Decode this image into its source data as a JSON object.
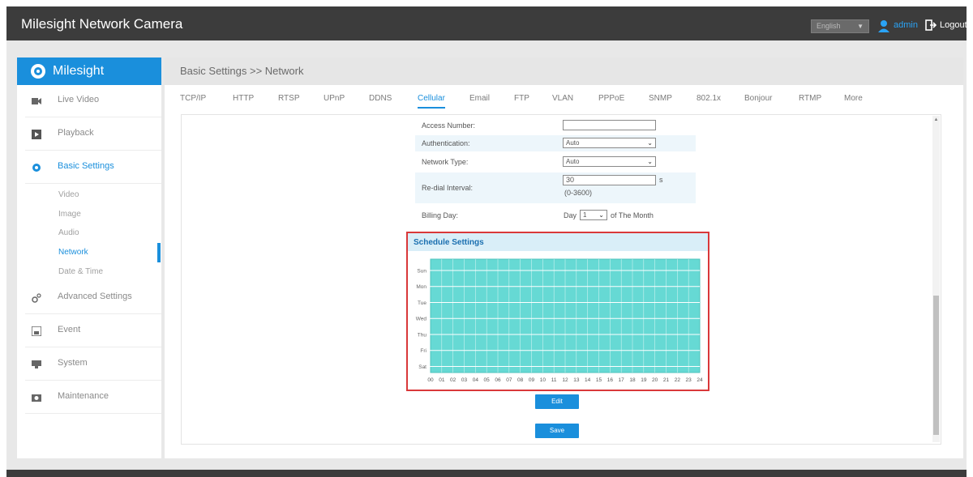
{
  "header": {
    "app_title": "Milesight Network Camera",
    "language": "English",
    "user": "admin",
    "logout": "Logout"
  },
  "sidebar": {
    "logo_text": "Milesight",
    "items": [
      {
        "label": "Live Video",
        "icon": "video-icon"
      },
      {
        "label": "Playback",
        "icon": "playback-icon"
      },
      {
        "label": "Basic Settings",
        "icon": "gear-icon"
      },
      {
        "label": "Advanced Settings",
        "icon": "advanced-gear-icon"
      },
      {
        "label": "Event",
        "icon": "event-icon"
      },
      {
        "label": "System",
        "icon": "system-icon"
      },
      {
        "label": "Maintenance",
        "icon": "maintenance-icon"
      }
    ],
    "sub_items": [
      "Video",
      "Image",
      "Audio",
      "Network",
      "Date & Time"
    ],
    "active_item": "Basic Settings",
    "active_sub_item": "Network"
  },
  "breadcrumb": "Basic Settings >> Network",
  "tabs": [
    "TCP/IP",
    "HTTP",
    "RTSP",
    "UPnP",
    "DDNS",
    "Cellular",
    "Email",
    "FTP",
    "VLAN",
    "PPPoE",
    "SNMP",
    "802.1x",
    "Bonjour",
    "RTMP",
    "More"
  ],
  "active_tab": "Cellular",
  "form": {
    "access_number": {
      "label": "Access Number:",
      "value": ""
    },
    "authentication": {
      "label": "Authentication:",
      "value": "Auto"
    },
    "network_type": {
      "label": "Network Type:",
      "value": "Auto"
    },
    "redial_interval": {
      "label": "Re-dial Interval:",
      "value": "30",
      "unit": "s",
      "range": "(0-3600)"
    },
    "billing_day": {
      "label": "Billing Day:",
      "prefix": "Day",
      "value": "1",
      "suffix": "of The Month"
    }
  },
  "schedule": {
    "title": "Schedule Settings",
    "days": [
      "Sun",
      "Mon",
      "Tue",
      "Wed",
      "Thu",
      "Fri",
      "Sat"
    ],
    "hours": [
      "00",
      "01",
      "02",
      "03",
      "04",
      "05",
      "06",
      "07",
      "08",
      "09",
      "10",
      "11",
      "12",
      "13",
      "14",
      "15",
      "16",
      "17",
      "18",
      "19",
      "20",
      "21",
      "22",
      "23",
      "24"
    ],
    "fill_color": "#66d9d4",
    "line_color": "#ffffff",
    "all_day_every_day": true
  },
  "buttons": {
    "edit": "Edit",
    "save": "Save"
  },
  "colors": {
    "accent": "#1a8fdc",
    "highlight_border": "#d9383a"
  }
}
